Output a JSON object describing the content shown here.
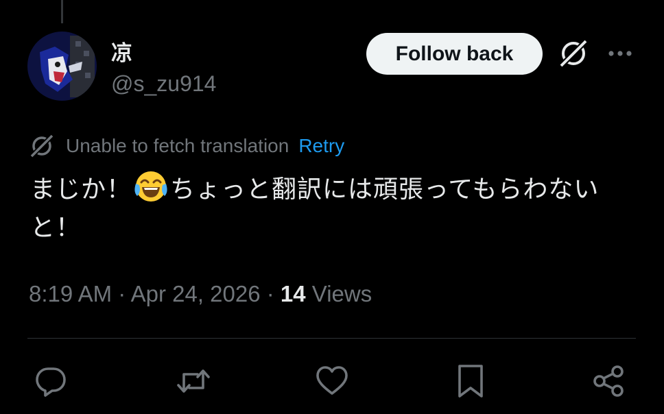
{
  "author": {
    "display_name": "凉",
    "handle": "@s_zu914"
  },
  "header": {
    "follow_label": "Follow back",
    "grok_icon": "grok-icon",
    "more_icon": "more-options-icon"
  },
  "translation": {
    "status_text": "Unable to fetch translation",
    "retry_label": "Retry"
  },
  "tweet": {
    "text_before_emoji": "まじか！",
    "emoji": "face-with-tears-of-joy",
    "text_after_emoji": "ちょっと翻訳には頑張ってもらわないと！"
  },
  "meta": {
    "time": "8:19 AM",
    "separator": " · ",
    "date": "Apr 24, 2026",
    "views_count": "14",
    "views_label": " Views"
  },
  "actions": [
    {
      "name": "reply",
      "icon": "reply-icon"
    },
    {
      "name": "repost",
      "icon": "repost-icon"
    },
    {
      "name": "like",
      "icon": "like-icon"
    },
    {
      "name": "bookmark",
      "icon": "bookmark-icon"
    },
    {
      "name": "share",
      "icon": "share-icon"
    }
  ],
  "colors": {
    "background": "#000000",
    "text_primary": "#e7e9ea",
    "text_secondary": "#71767b",
    "link": "#1d9bf0",
    "button_bg": "#eff3f4"
  }
}
